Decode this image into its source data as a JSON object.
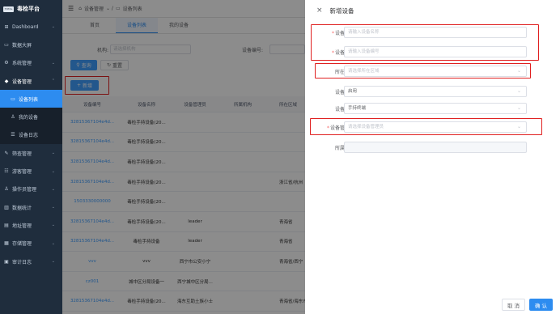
{
  "app": {
    "title": "毒检平台",
    "logo_text": "TOTAL"
  },
  "sidebar": {
    "items": [
      {
        "icon": "⊞",
        "label": "Dashboard",
        "arrow": "⌄",
        "kind": "top"
      },
      {
        "icon": "▭",
        "label": "数据大屏",
        "arrow": "",
        "kind": "top"
      },
      {
        "icon": "⚙",
        "label": "系统管理",
        "arrow": "⌄",
        "kind": "top"
      },
      {
        "icon": "◆",
        "label": "设备管理",
        "arrow": "⌃",
        "kind": "open"
      },
      {
        "icon": "▭",
        "label": "设备列表",
        "arrow": "",
        "kind": "sub-active"
      },
      {
        "icon": "♙",
        "label": "我的设备",
        "arrow": "",
        "kind": "sub"
      },
      {
        "icon": "☰",
        "label": "设备日志",
        "arrow": "",
        "kind": "sub"
      },
      {
        "icon": "✎",
        "label": "筛查管理",
        "arrow": "⌄",
        "kind": "top"
      },
      {
        "icon": "☷",
        "label": "游客管理",
        "arrow": "⌄",
        "kind": "top"
      },
      {
        "icon": "♙",
        "label": "操作员管理",
        "arrow": "⌄",
        "kind": "top"
      },
      {
        "icon": "▥",
        "label": "数据统计",
        "arrow": "⌄",
        "kind": "top"
      },
      {
        "icon": "▤",
        "label": "地址管理",
        "arrow": "⌄",
        "kind": "top"
      },
      {
        "icon": "▦",
        "label": "存储管理",
        "arrow": "⌄",
        "kind": "top"
      },
      {
        "icon": "▣",
        "label": "审计日志",
        "arrow": "⌄",
        "kind": "top"
      }
    ]
  },
  "topbar": {
    "menu_icon": "☰",
    "home_icon": "⌂",
    "crumb1": "设备管理",
    "sep": "⌄ /",
    "crumb_icon": "▭",
    "crumb2": "设备列表"
  },
  "tabs": [
    "首页",
    "设备列表",
    "我的设备"
  ],
  "search": {
    "org_label": "机构:",
    "org_placeholder": "请选择机构",
    "code_label": "设备编号:",
    "query_label": "查询",
    "reset_label": "重置",
    "add_label": "新增"
  },
  "table": {
    "headers": [
      "设备编号",
      "设备名称",
      "设备管理员",
      "所属机构",
      "所在区域"
    ],
    "rows": [
      [
        "32815367104e4d...",
        "毒检手持设备(20...",
        "",
        "",
        ""
      ],
      [
        "32815367104e4d...",
        "毒检手持设备(20...",
        "",
        "",
        ""
      ],
      [
        "32815367104e4d...",
        "毒检手持设备(20...",
        "",
        "",
        ""
      ],
      [
        "32815367104e4d...",
        "毒检手持设备(20...",
        "",
        "",
        "浙江省/杭州"
      ],
      [
        "1503330000000",
        "毒检手持设备(20...",
        "",
        "",
        ""
      ],
      [
        "32815367104e4d...",
        "毒检手持设备(20...",
        "leader",
        "",
        "青海省"
      ],
      [
        "32815367104e4d...",
        "毒检手持设备",
        "leader",
        "",
        "青海省"
      ],
      [
        "vvv",
        "vvv",
        "西宁市公安小宁",
        "",
        "青海省/西宁"
      ],
      [
        "cz001",
        "城中区分局设备一",
        "西宁城中区分局...",
        "",
        ""
      ],
      [
        "32815367104e4d...",
        "毒检手持设备(20...",
        "海东互助土族小士",
        "",
        "青海省/海东市"
      ]
    ]
  },
  "drawer": {
    "close_icon": "×",
    "title": "新增设备",
    "fields": [
      {
        "label": "设备名称:",
        "required": true,
        "value": "请输入设备名称",
        "is_placeholder": true,
        "select": false,
        "disabled": false
      },
      {
        "label": "设备编号:",
        "required": true,
        "value": "请输入设备编号",
        "is_placeholder": true,
        "select": false,
        "disabled": false
      },
      {
        "label": "所在区域:",
        "required": false,
        "value": "请选择所在区域",
        "is_placeholder": true,
        "select": true,
        "disabled": false
      },
      {
        "label": "设备状态:",
        "required": false,
        "value": "启用",
        "is_placeholder": false,
        "select": true,
        "disabled": false
      },
      {
        "label": "设备类型:",
        "required": false,
        "value": "手持终端",
        "is_placeholder": false,
        "select": true,
        "disabled": false
      },
      {
        "label": "设备管理员:",
        "required": true,
        "value": "请选择设备管理员",
        "is_placeholder": true,
        "select": true,
        "disabled": false
      },
      {
        "label": "所属机构:",
        "required": false,
        "value": "",
        "is_placeholder": true,
        "select": false,
        "disabled": true
      }
    ],
    "cancel_label": "取 消",
    "confirm_label": "确 认"
  },
  "colors": {
    "primary": "#409eff",
    "sidebar": "#1f2d3d",
    "highlight": "#e02020"
  }
}
